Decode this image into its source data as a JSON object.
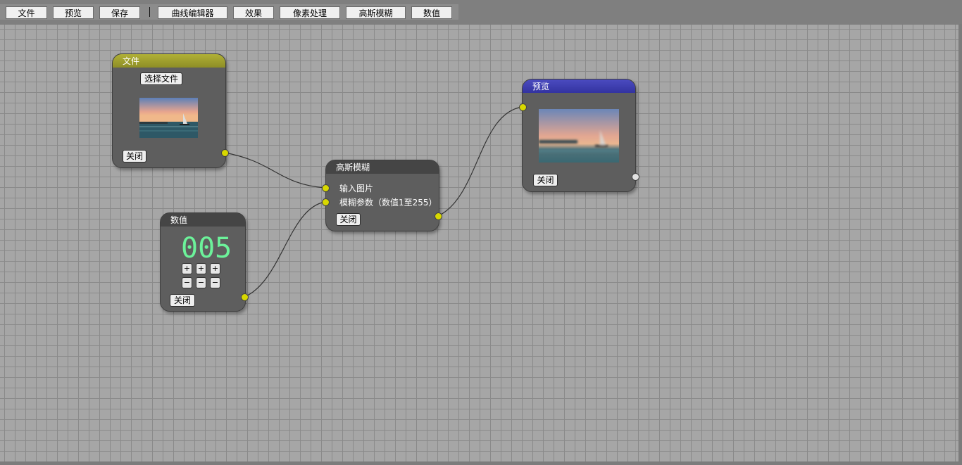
{
  "toolbar": {
    "file": "文件",
    "preview": "预览",
    "save": "保存",
    "curve_editor": "曲线编辑器",
    "effects": "效果",
    "pixel_process": "像素处理",
    "gaussian_blur": "高斯模糊",
    "value": "数值"
  },
  "nodes": {
    "file": {
      "title": "文件",
      "select_label": "选择文件",
      "close_label": "关闭",
      "header_color": "#9c9c2a"
    },
    "value": {
      "title": "数值",
      "digits": "005",
      "plus": "+",
      "minus": "−",
      "close_label": "关闭",
      "header_color": "#444444",
      "digit_color": "#6cf29a"
    },
    "blur": {
      "title": "高斯模糊",
      "input_image": "输入图片",
      "blur_param": "模糊参数（数值1至255）",
      "close_label": "关闭",
      "header_color": "#444444"
    },
    "preview": {
      "title": "预览",
      "close_label": "关闭",
      "header_color": "#3a3aa8"
    }
  },
  "colors": {
    "port": "#d8d800",
    "wire": "#333333",
    "canvas": "#a6a6a6",
    "grid": "#8a8a8a"
  }
}
